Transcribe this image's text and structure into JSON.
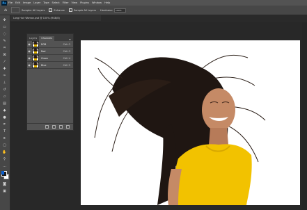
{
  "app": {
    "logo": "Ps"
  },
  "menu": [
    "File",
    "Edit",
    "Image",
    "Layer",
    "Type",
    "Select",
    "Filter",
    "View",
    "Plugins",
    "Window",
    "Help"
  ],
  "options": {
    "sample_label": "Sample:",
    "sample_value": "All Layers",
    "enhance_label": "Enhance",
    "sample_all_label": "Sample All Layers",
    "hardness_label": "Hardness:",
    "hardness_value": "100%"
  },
  "document": {
    "tab_title": "Long Hair Woman.psd @ 100% (RGB/8)"
  },
  "panel": {
    "tabs": [
      "Layers",
      "Channels"
    ],
    "active_tab": "Channels",
    "channels": [
      {
        "name": "RGB",
        "shortcut": "Ctrl+2"
      },
      {
        "name": "Red",
        "shortcut": "Ctrl+3"
      },
      {
        "name": "Green",
        "shortcut": "Ctrl+4"
      },
      {
        "name": "Blue",
        "shortcut": "Ctrl+5"
      }
    ]
  },
  "colors": {
    "menubar": "#535353",
    "panel": "#535353",
    "workspace": "#282828",
    "canvas": "#ffffff",
    "shirt": "#f2c200",
    "hair": "#1f1612"
  },
  "icons": [
    "home-icon",
    "move-icon",
    "eye-icon",
    "panel-menu-icon"
  ]
}
